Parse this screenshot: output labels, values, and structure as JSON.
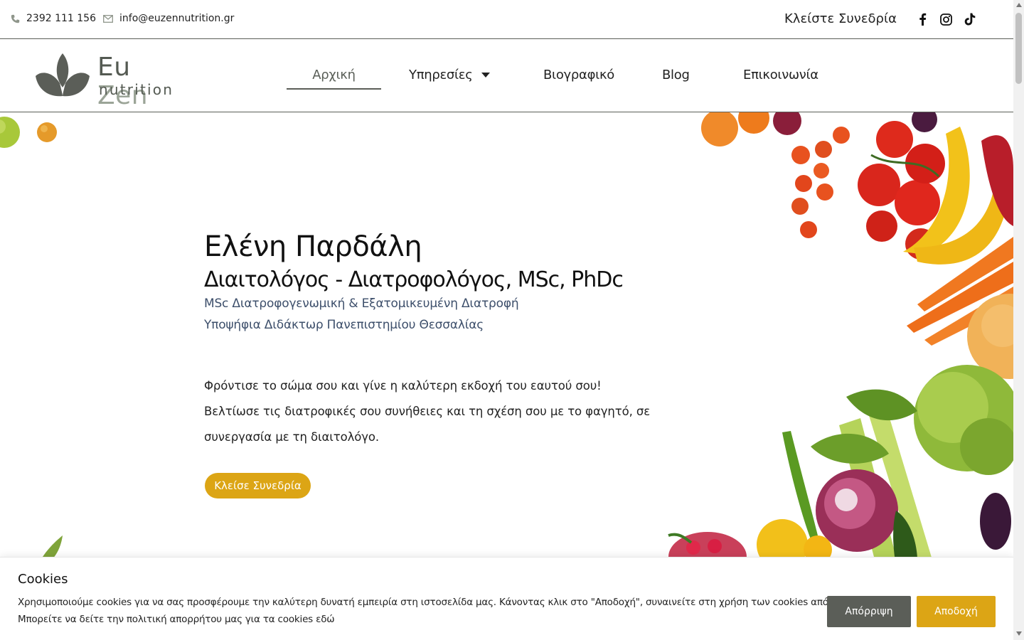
{
  "topbar": {
    "phone": "2392 111 156",
    "email": "info@euzennutrition.gr",
    "book_link": "Κλείστε Συνεδρία",
    "social_icons": [
      "facebook-icon",
      "instagram-icon",
      "tiktok-icon"
    ]
  },
  "logo": {
    "word1": "Eu",
    "word2": "Zen",
    "word3": "nutrition"
  },
  "nav": {
    "items": [
      {
        "label": "Αρχική",
        "active": true
      },
      {
        "label": "Υπηρεσίες",
        "has_dropdown": true
      },
      {
        "label": "Βιογραφικό"
      },
      {
        "label": "Blog"
      },
      {
        "label": "Επικοινωνία"
      }
    ]
  },
  "hero": {
    "name": "Ελένη Παρδάλη",
    "title": "Διαιτολόγος - Διατροφολόγος, MSc,  PhDc",
    "credentials": [
      "MSc Διατροφογενωμική & Εξατομικευμένη Διατροφή",
      "Υποψήφια Διδάκτωρ Πανεπιστημίου Θεσσαλίας"
    ],
    "body": [
      "Φρόντισε το σώμα σου και γίνε η καλύτερη εκδοχή του εαυτού σου!",
      "Βελτίωσε τις διατροφικές σου συνήθειες και τη σχέση σου με το φαγητό, σε",
      "συνεργασία με τη διαιτολόγο."
    ],
    "cta": "Κλείσε Συνεδρία"
  },
  "cookies": {
    "title": "Cookies",
    "line1": "Χρησιμοποιούμε cookies για να σας προσφέρουμε την καλύτερη δυνατή εμπειρία στη ιστοσελίδα μας. Κάνοντας κλικ στο \"Αποδοχή\", συναινείτε στη χρήση των cookies από εμάς.",
    "line2": "Μπορείτε να δείτε την πολιτική απορρήτου μας για τα cookies εδώ",
    "reject": "Απόρριψη",
    "accept": "Αποδοχή"
  },
  "colors": {
    "accent": "#dca515",
    "dark_grey": "#5b5e58",
    "credential_text": "#3d4f6b"
  }
}
